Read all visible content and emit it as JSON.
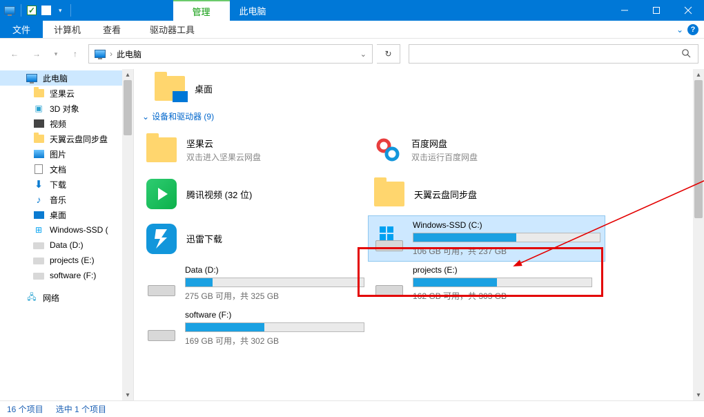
{
  "window": {
    "manage_tab": "管理",
    "title": "此电脑",
    "file": "文件",
    "tabs": [
      "计算机",
      "查看"
    ],
    "tool_tab": "驱动器工具"
  },
  "address": {
    "crumb": "此电脑",
    "search_placeholder": ""
  },
  "sidebar": {
    "items": [
      {
        "label": "此电脑",
        "icon": "pc",
        "selected": true
      },
      {
        "label": "坚果云",
        "icon": "folder"
      },
      {
        "label": "3D 对象",
        "icon": "3d"
      },
      {
        "label": "视频",
        "icon": "video"
      },
      {
        "label": "天翼云盘同步盘",
        "icon": "folder"
      },
      {
        "label": "图片",
        "icon": "pic"
      },
      {
        "label": "文档",
        "icon": "doc"
      },
      {
        "label": "下载",
        "icon": "down"
      },
      {
        "label": "音乐",
        "icon": "music"
      },
      {
        "label": "桌面",
        "icon": "desk"
      },
      {
        "label": "Windows-SSD (",
        "icon": "win"
      },
      {
        "label": "Data (D:)",
        "icon": "hd"
      },
      {
        "label": "projects (E:)",
        "icon": "hd"
      },
      {
        "label": "software (F:)",
        "icon": "hd"
      }
    ],
    "network": "网络"
  },
  "content": {
    "desktop": "桌面",
    "section": "设备和驱动器 (9)",
    "tiles": [
      {
        "name": "坚果云",
        "desc": "双击进入坚果云网盘",
        "icon": "folder"
      },
      {
        "name": "百度网盘",
        "desc": "双击运行百度网盘",
        "icon": "baidu"
      },
      {
        "name": "腾讯视频 (32 位)",
        "desc": "",
        "icon": "tencent"
      },
      {
        "name": "天翼云盘同步盘",
        "desc": "",
        "icon": "folder"
      },
      {
        "name": "迅雷下载",
        "desc": "",
        "icon": "xunlei"
      }
    ],
    "drives": [
      {
        "name": "Windows-SSD (C:)",
        "free": "106 GB 可用，共 237 GB",
        "pct": 55,
        "win": true,
        "selected": true
      },
      {
        "name": "Data (D:)",
        "free": "275 GB 可用，共 325 GB",
        "pct": 15
      },
      {
        "name": "projects (E:)",
        "free": "162 GB 可用，共 303 GB",
        "pct": 47
      },
      {
        "name": "software (F:)",
        "free": "169 GB 可用，共 302 GB",
        "pct": 44
      }
    ]
  },
  "status": {
    "count": "16 个项目",
    "sel": "选中 1 个项目"
  }
}
